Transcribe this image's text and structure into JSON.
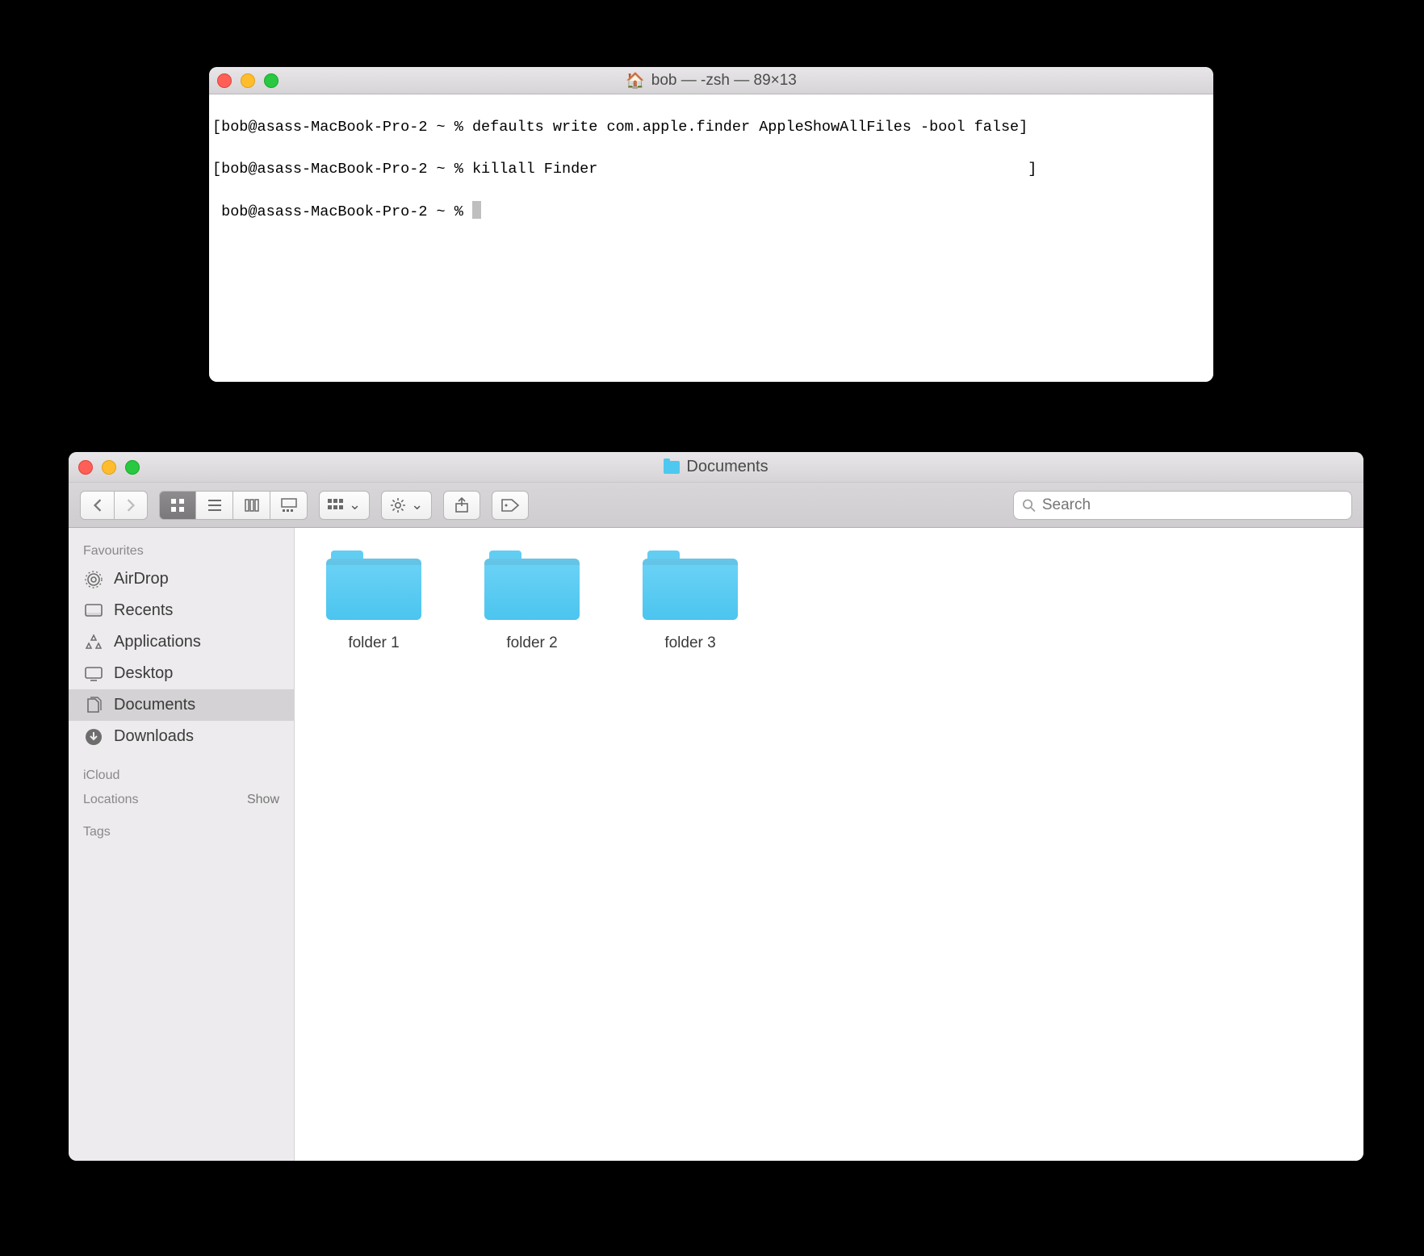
{
  "terminal": {
    "title": "bob — -zsh — 89×13",
    "home_icon_label": "home-icon",
    "lines": [
      "[bob@asass-MacBook-Pro-2 ~ % defaults write com.apple.finder AppleShowAllFiles -bool false]",
      "[bob@asass-MacBook-Pro-2 ~ % killall Finder                                                ]",
      " bob@asass-MacBook-Pro-2 ~ % "
    ]
  },
  "finder": {
    "title": "Documents",
    "search_placeholder": "Search",
    "sidebar": {
      "favourites_label": "Favourites",
      "icloud_label": "iCloud",
      "locations_label": "Locations",
      "locations_show": "Show",
      "tags_label": "Tags",
      "items": [
        {
          "id": "airdrop",
          "label": "AirDrop"
        },
        {
          "id": "recents",
          "label": "Recents"
        },
        {
          "id": "applications",
          "label": "Applications"
        },
        {
          "id": "desktop",
          "label": "Desktop"
        },
        {
          "id": "documents",
          "label": "Documents",
          "selected": true
        },
        {
          "id": "downloads",
          "label": "Downloads"
        }
      ]
    },
    "folders": [
      {
        "name": "folder 1"
      },
      {
        "name": "folder 2"
      },
      {
        "name": "folder 3"
      }
    ]
  }
}
